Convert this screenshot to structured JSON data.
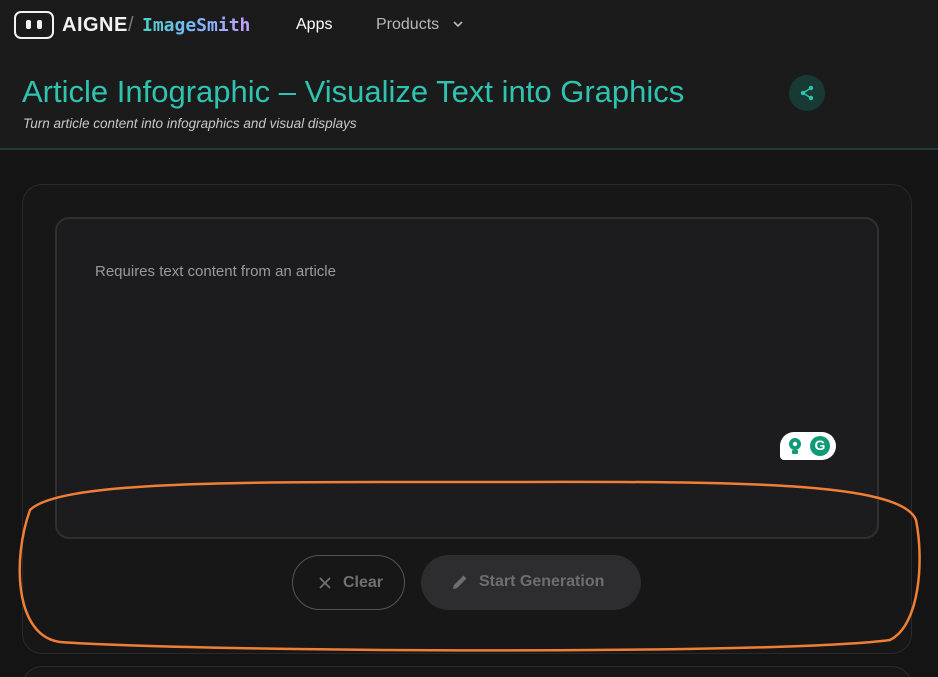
{
  "nav": {
    "brand": "AIGNE",
    "separator": "/",
    "app_name": "ImageSmith",
    "items": [
      {
        "label": "Apps"
      },
      {
        "label": "Products"
      }
    ]
  },
  "header": {
    "title": "Article Infographic – Visualize Text into Graphics",
    "subtitle": "Turn article content into infographics and visual displays"
  },
  "form": {
    "input_value": "",
    "input_placeholder": "Requires text content from an article",
    "clear_label": "Clear",
    "start_label": "Start Generation"
  },
  "colors": {
    "accent": "#2ec4b0",
    "background": "#141415",
    "annotation": "#f07f35",
    "grammarly": "#0f9b77"
  },
  "icons": {
    "logo": "robot-face-icon",
    "products": "chevron-down-icon",
    "share": "share-icon",
    "clear": "close-icon",
    "start": "pencil-icon",
    "grammarly": "grammarly-icon"
  }
}
